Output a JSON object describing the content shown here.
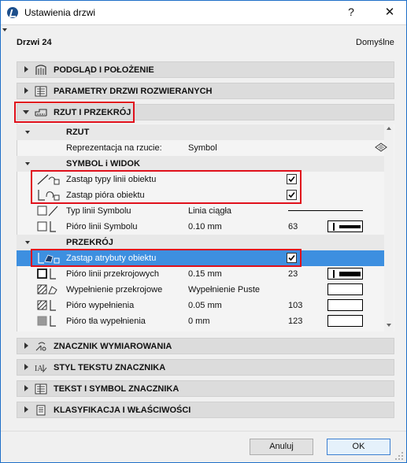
{
  "window": {
    "title": "Ustawienia drzwi",
    "help": "?",
    "close": "✕"
  },
  "header": {
    "object_name": "Drzwi 24",
    "preset": "Domyślne"
  },
  "panels": {
    "preview": "PODGLĄD I POŁOŻENIE",
    "params": "PARAMETRY DRZWI ROZWIERANYCH",
    "plan_section": "RZUT I PRZEKRÓJ",
    "dimension_marker": "ZNACZNIK WYMIAROWANIA",
    "marker_text_style": "STYL TEKSTU ZNACZNIKA",
    "marker_text_symbol": "TEKST I SYMBOL ZNACZNIKA",
    "classification": "KLASYFIKACJA I WŁAŚCIWOŚCI"
  },
  "plan": {
    "heading": "RZUT",
    "representation_label": "Reprezentacja na rzucie:",
    "representation_value": "Symbol"
  },
  "symbol": {
    "heading": "SYMBOL i WIDOK",
    "override_line_types": {
      "label": "Zastąp typy linii obiektu",
      "checked": true
    },
    "override_pens": {
      "label": "Zastąp pióra obiektu",
      "checked": true
    },
    "line_type": {
      "label": "Typ linii Symbolu",
      "value": "Linia ciągła"
    },
    "line_pen": {
      "label": "Pióro linii Symbolu",
      "value": "0.10 mm",
      "pen": "63"
    }
  },
  "section": {
    "heading": "PRZEKRÓJ",
    "override_attrs": {
      "label": "Zastąp atrybuty obiektu",
      "checked": true
    },
    "cut_line_pen": {
      "label": "Pióro linii przekrojowych",
      "value": "0.15 mm",
      "pen": "23"
    },
    "cut_fill": {
      "label": "Wypełnienie przekrojowe",
      "value": "Wypełnienie Puste"
    },
    "fill_pen": {
      "label": "Pióro wypełnienia",
      "value": "0.05 mm",
      "pen": "103"
    },
    "fill_bg_pen": {
      "label": "Pióro tła wypełnienia",
      "value": "0 mm",
      "pen": "123"
    }
  },
  "buttons": {
    "cancel": "Anuluj",
    "ok": "OK"
  },
  "colors": {
    "selection": "#3d8fe0",
    "highlight_box": "#e0101b",
    "panel_header": "#dcdcdc"
  }
}
